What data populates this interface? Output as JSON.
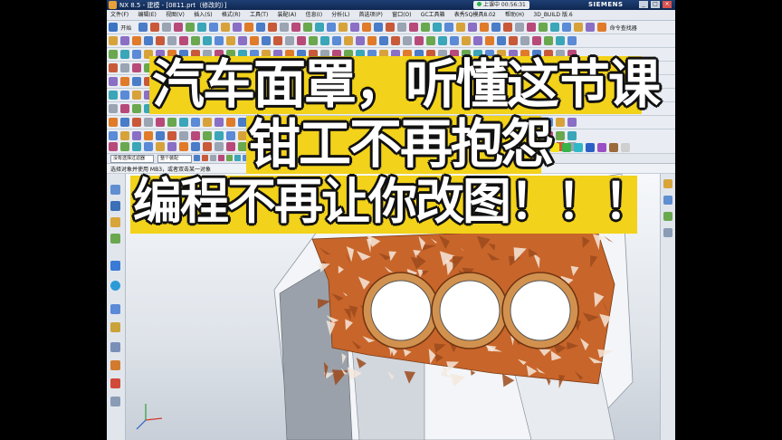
{
  "window": {
    "title": "NX 8.5 - 建模 - [0811.prt（修改的）]",
    "timer_label": "上课中 00:56:31",
    "brand": "SIEMENS",
    "controls": [
      "_",
      "□",
      "×"
    ]
  },
  "menubar": {
    "items": [
      "文件(F)",
      "编辑(E)",
      "视图(V)",
      "插入(S)",
      "格式(R)",
      "工具(T)",
      "装配(A)",
      "信息(I)",
      "分析(L)",
      "首选项(P)",
      "窗口(O)",
      "GC工具箱",
      "表秀5Q模具8.02",
      "帮助(H)",
      "3D_BUILD 版.6"
    ]
  },
  "toolbar": {
    "start_label": "开始",
    "command_finder_label": "命令查找器"
  },
  "filterbar": {
    "filter_value": "没有选择过滤器",
    "scope_value": "整个装配"
  },
  "prompt": {
    "text": "选择对象并使用 MB3，或者双击某一对象"
  },
  "caption": {
    "line1": "汽车面罩，听懂这节课",
    "line2": "钳工不再抱怨",
    "line3": "编程不再让你改图！！！"
  },
  "colors": {
    "caption_fill": "#f2d21a",
    "model_orange": "#c8652a",
    "titlebar": "#1f3f74"
  },
  "icons": [
    "nx-app-icon",
    "new-file-icon",
    "open-icon",
    "save-icon",
    "undo-icon",
    "redo-icon",
    "sketch-icon",
    "extrude-icon",
    "revolve-icon",
    "hole-icon",
    "blend-icon",
    "chamfer-icon",
    "shell-icon",
    "draft-icon",
    "trim-body-icon",
    "color-palette-icon",
    "wcs-icon"
  ]
}
